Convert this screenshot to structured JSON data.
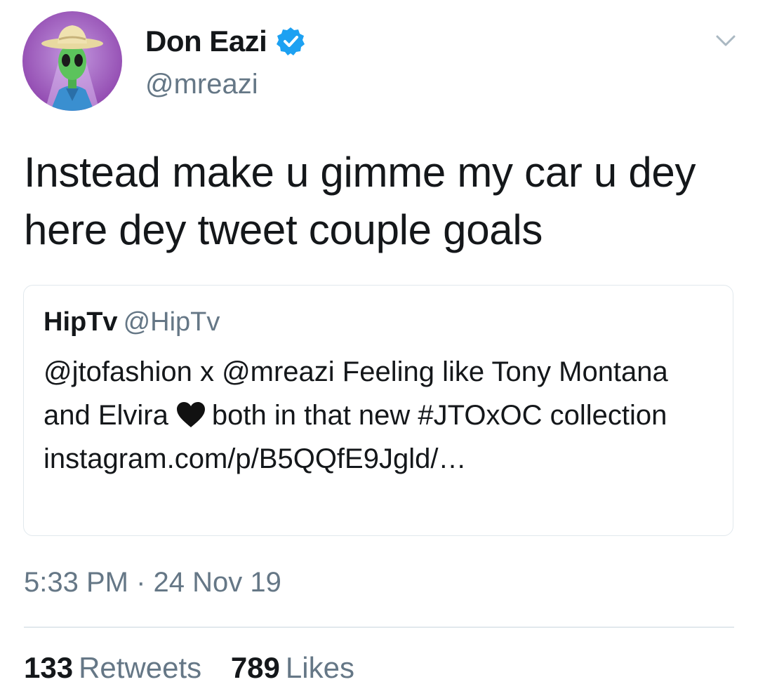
{
  "author": {
    "display_name": "Don Eazi",
    "handle": "@mreazi",
    "verified": true,
    "avatar_icon": "alien-with-sombrero-avatar"
  },
  "tweet": {
    "text": "Instead make u gimme my car u dey here dey tweet couple goals"
  },
  "quoted_tweet": {
    "display_name": "HipTv",
    "handle": "@HipTv",
    "text_before_emoji": "@jtofashion x @mreazi  Feeling like Tony Montana and Elvira",
    "emoji_icon": "black-heart-icon",
    "text_after_emoji": "both in that new #JTOxOC collection instagram.com/p/B5QQfE9Jgld/…"
  },
  "timestamp": "5:33 PM · 24 Nov 19",
  "stats": {
    "retweets_count": "133",
    "retweets_label": "Retweets",
    "likes_count": "789",
    "likes_label": "Likes"
  },
  "colors": {
    "primary_text": "#14171a",
    "secondary_text": "#657786",
    "border": "#e1e8ed",
    "verified_blue": "#1da1f2",
    "avatar_background": "#9b59b6"
  }
}
